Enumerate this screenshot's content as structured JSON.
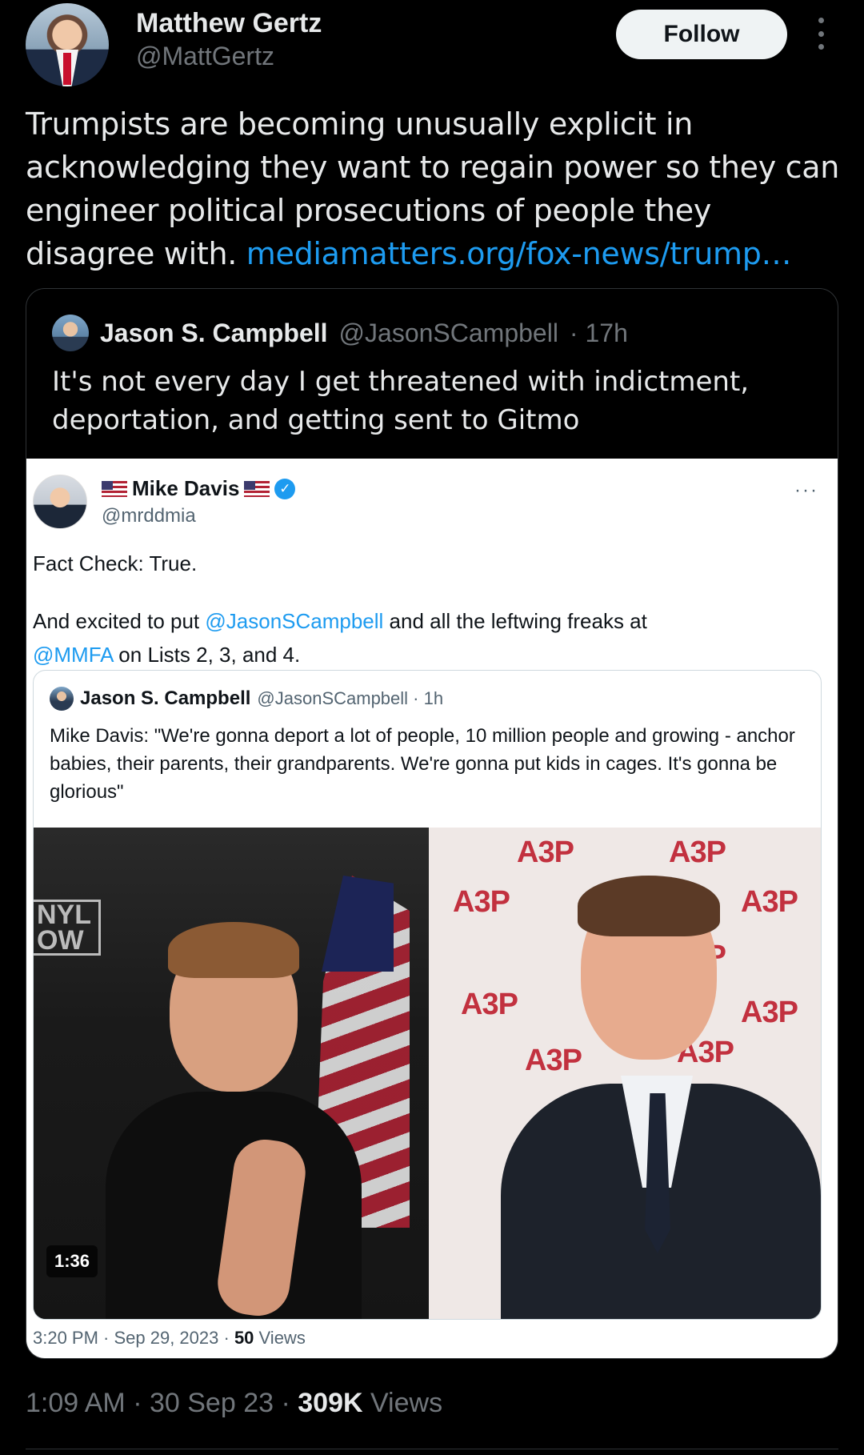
{
  "tweet": {
    "author_name": "Matthew Gertz",
    "author_handle": "@MattGertz",
    "follow_label": "Follow",
    "text": "Trumpists are becoming unusually explicit in acknowledging they want to regain power so they can engineer political prosecutions of people they disagree with. ",
    "link": "mediamatters.org/fox-news/trump…",
    "time": "1:09 AM",
    "date": "30 Sep 23",
    "views_count": "309K",
    "views_label": "Views"
  },
  "quote": {
    "author_name": "Jason S. Campbell",
    "author_handle": "@JasonSCampbell",
    "age": "· 17h",
    "text": "It's not every day I get threatened with indictment, deportation, and getting sent to Gitmo"
  },
  "screenshot_tweet": {
    "author_name": "Mike Davis",
    "author_handle": "@mrddmia",
    "more": "···",
    "line1": "Fact Check: True.",
    "line2_pre": "And excited to put ",
    "mention1": "@JasonSCampbell",
    "line2_post": " and all the leftwing freaks at",
    "mention2": "@MMFA",
    "line3_post": " on Lists 2, 3, and 4.",
    "footer_time": "3:20 PM · Sep 29, 2023 · ",
    "footer_views_count": "50",
    "footer_views_label": " Views"
  },
  "inner_quote": {
    "author_name": "Jason S. Campbell",
    "author_handle": "@JasonSCampbell · 1h",
    "text": "Mike Davis: \"We're gonna deport a lot of people, 10 million people and growing - anchor babies, their parents, their grandparents. We're gonna put kids in cages. It's gonna be glorious\"",
    "video_duration": "1:36",
    "sign_text": "NYL\nOW",
    "wall_text": "A3P"
  },
  "colors": {
    "background": "#000000",
    "link": "#1d9bf0",
    "muted": "#71767b",
    "text": "#e7e9ea"
  }
}
